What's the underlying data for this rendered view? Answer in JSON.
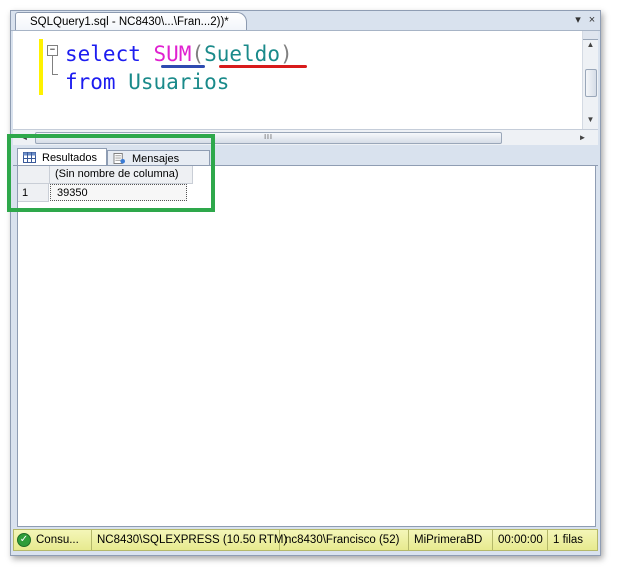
{
  "document_tab": {
    "title": "SQLQuery1.sql - NC8430\\...\\Fran...2))*",
    "controls": [
      "▾",
      "×"
    ]
  },
  "editor": {
    "line1": {
      "keyword": "select",
      "function": "SUM",
      "open_paren": "(",
      "identifier": "Sueldo",
      "close_paren": ")"
    },
    "line2": {
      "keyword": "from",
      "identifier": "Usuarios"
    },
    "collapse_symbol": "−"
  },
  "scrollbars": {
    "h_grip": "III",
    "left_arrow": "◄",
    "right_arrow": "►",
    "up_arrow": "▲",
    "down_arrow": "▼"
  },
  "result_tabs": [
    {
      "label": "Resultados",
      "icon": "grid-icon",
      "active": true
    },
    {
      "label": "Mensajes",
      "icon": "messages-icon",
      "active": false
    }
  ],
  "results_grid": {
    "columns": [
      "(Sin nombre de columna)"
    ],
    "rows": [
      {
        "row_number": "1",
        "values": [
          "39350"
        ]
      }
    ]
  },
  "status_bar": {
    "status": "Consu...",
    "server": "NC8430\\SQLEXPRESS (10.50 RTM)",
    "user": "nc8430\\Francisco (52)",
    "database": "MiPrimeraBD",
    "elapsed": "00:00:00",
    "rows": "1 filas",
    "status_icon": "check-icon"
  },
  "colors": {
    "keyword": "#1c1cf0",
    "function": "#e020d0",
    "identifier": "#1a8a8a",
    "sum_underline": "#2e4ab0",
    "sueldo_underline": "#d81b1b",
    "annotation_box": "#2ea84b",
    "status_bar": "#e7ea8f"
  }
}
